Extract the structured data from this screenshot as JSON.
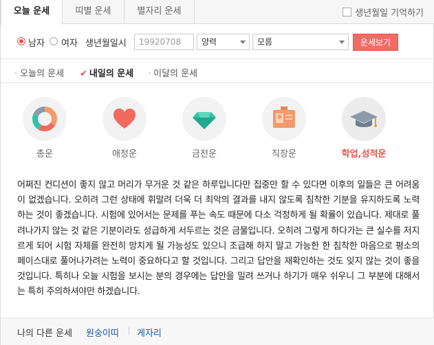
{
  "tabs": [
    {
      "label": "오늘 운세",
      "active": true
    },
    {
      "label": "띠별 운세",
      "active": false
    },
    {
      "label": "별자리 운세",
      "active": false
    }
  ],
  "remember_label": "생년월일 기억하기",
  "form": {
    "gender_male": "남자",
    "gender_female": "여자",
    "selected_gender": "남자",
    "birth_label": "생년월일시",
    "birth_placeholder": "19920708",
    "calendar_value": "양력",
    "time_value": "모름",
    "submit_label": "운세보기"
  },
  "subtabs": [
    {
      "label": "오늘의 운세",
      "active": false
    },
    {
      "label": "내일의 운세",
      "active": true
    },
    {
      "label": "이달의 운세",
      "active": false
    }
  ],
  "categories": [
    {
      "label": "총운",
      "icon": "donut-chart-icon",
      "active": false
    },
    {
      "label": "애정운",
      "icon": "heart-icon",
      "active": false
    },
    {
      "label": "금전운",
      "icon": "diamond-icon",
      "active": false
    },
    {
      "label": "직장운",
      "icon": "id-badge-icon",
      "active": false
    },
    {
      "label": "학업,성적운",
      "icon": "graduation-cap-icon",
      "active": true
    }
  ],
  "fortune_text": "어쩌진 컨디션이 좋지 않고 머리가 무거운 것 같은 하루입니다만 집중만 할 수 있다면 이후의 일들은 큰 어려움이 없겠습니다. 오히려 그런 상태에 휘말려 더욱 더 최악의 결과를 내지 않도록 침착한 기분을 유지하도록 노력하는 것이 좋겠습니다. 시험에 있어서는 문제를 푸는 속도 때문에 다소 걱정하게 될 확률이 있습니다. 제대로 풀려나가지 않는 것 같은 기분이라도 성급하게 서두르는 것은 금물입니다. 오히려 그렇게 하다가는 큰 실수를 저지르게 되어 시험 자체를 완전히 망치게 될 가능성도 있으니 조급해 하지 말고 가능한 한 침착한 마음으로 평소의 페이스대로 풀어나가려는 노력이 중요하다고 할 것입니다. 그리고 답안을 재확인하는 것도 잊지 않는 것이 좋을 것입니다. 특히나 오늘 시험을 보시는 분의 경우에는 답안을 밀려 쓰거나 하기가 매우 쉬우니 그 부분에 대해서는 특히 주의하셔야만 하겠습니다.",
  "footer": {
    "label": "나의 다른 운세",
    "link1": "원숭이띠",
    "link2": "게자리"
  },
  "colors": {
    "accent": "#e8524a",
    "button": "#f26b64",
    "heart": "#f06b5e",
    "diamond": "#2ec4a6",
    "badge": "#f29a6b",
    "cap": "#8a9aa8"
  }
}
